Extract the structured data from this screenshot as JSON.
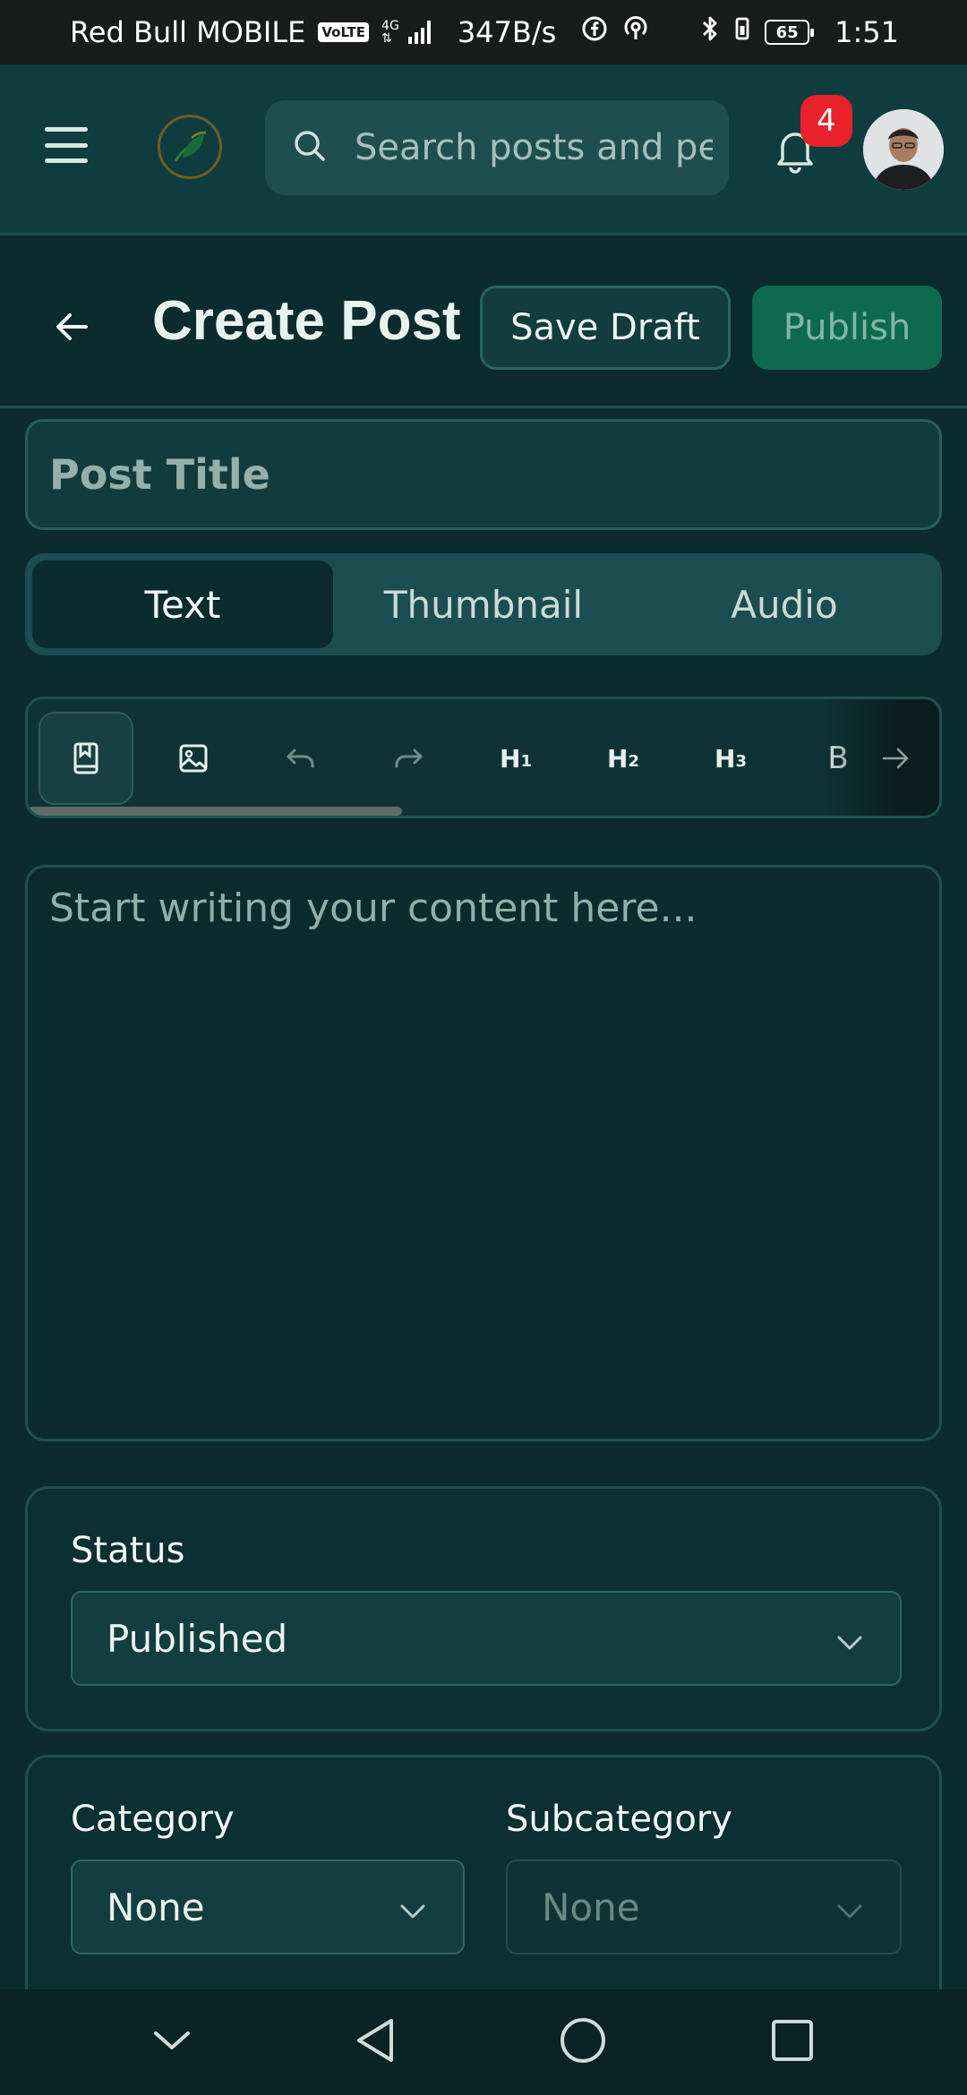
{
  "status_bar": {
    "carrier": "Red Bull MOBILE",
    "volte": "VoLTE",
    "network_type": "4G",
    "speed": "347B/s",
    "battery": "65",
    "time": "1:51"
  },
  "header": {
    "search_placeholder": "Search posts and pe",
    "notification_count": "4"
  },
  "post_header": {
    "title": "Create Post",
    "save_draft_label": "Save Draft",
    "publish_label": "Publish"
  },
  "editor": {
    "title_placeholder": "Post Title",
    "tabs": [
      {
        "label": "Text",
        "active": true
      },
      {
        "label": "Thumbnail",
        "active": false
      },
      {
        "label": "Audio",
        "active": false
      }
    ],
    "toolbar": {
      "h1": "H",
      "h2": "H",
      "h3": "H",
      "h1_sub": "1",
      "h2_sub": "2",
      "h3_sub": "3",
      "bold": "B"
    },
    "content_placeholder": "Start writing your content here..."
  },
  "status_section": {
    "label": "Status",
    "value": "Published"
  },
  "category_section": {
    "category_label": "Category",
    "category_value": "None",
    "subcategory_label": "Subcategory",
    "subcategory_value": "None"
  },
  "colors": {
    "background": "#0b2b2f",
    "header": "#0f3c3f",
    "accent": "#0d6a4d",
    "badge": "#e8212b"
  }
}
